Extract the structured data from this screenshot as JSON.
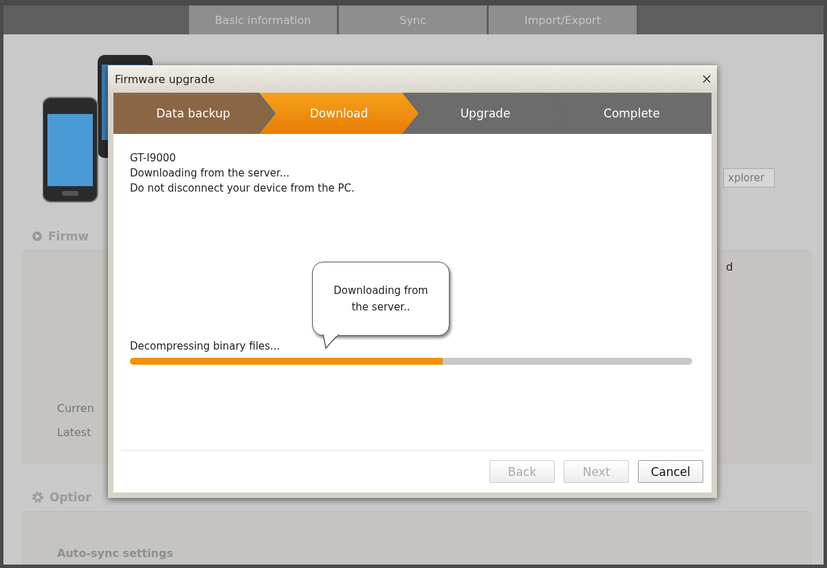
{
  "background": {
    "tabs": [
      "Basic information",
      "Sync",
      "Import/Export"
    ],
    "firmware_heading": "Firmw",
    "current_label": "Curren",
    "latest_label": "Latest",
    "options_heading": "Optior",
    "auto_sync_label": "Auto-sync settings",
    "explorer_button": "xplorer",
    "fragment": "d"
  },
  "dialog": {
    "title": "Firmware upgrade",
    "steps": [
      {
        "label": "Data backup",
        "done": true,
        "selected": false
      },
      {
        "label": "Download",
        "done": false,
        "selected": true
      },
      {
        "label": "Upgrade",
        "done": false,
        "selected": false
      },
      {
        "label": "Complete",
        "done": false,
        "selected": false
      }
    ],
    "lines": [
      "GT-I9000",
      "Downloading from the server...",
      "Do not disconnect your device from the PC."
    ],
    "bubble": "Downloading from the server..",
    "progress": {
      "label": "Decompressing binary files...",
      "level": 0.556
    },
    "buttons": [
      {
        "label": "Back",
        "disabled": true
      },
      {
        "label": "Next",
        "disabled": true
      },
      {
        "label": "Cancel",
        "disabled": false
      }
    ]
  }
}
